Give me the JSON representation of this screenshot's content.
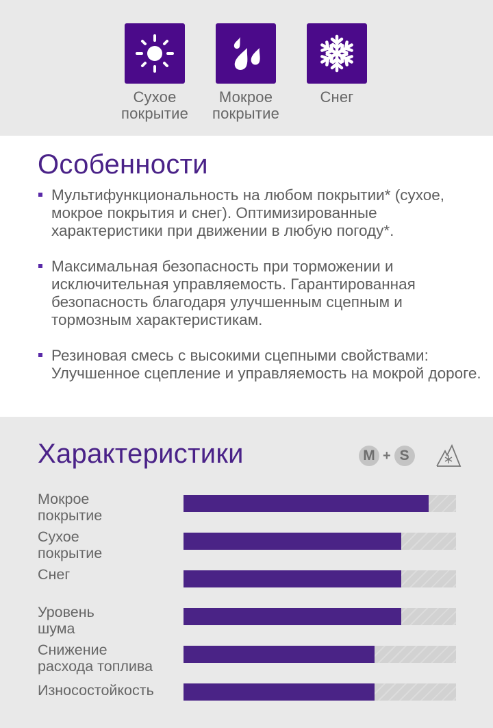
{
  "conditions": [
    {
      "icon": "sun-icon",
      "label_line1": "Сухое",
      "label_line2": "покрытие"
    },
    {
      "icon": "raindrops-icon",
      "label_line1": "Мокрое",
      "label_line2": "покрытие"
    },
    {
      "icon": "snowflake-icon",
      "label_line1": "Снег",
      "label_line2": ""
    }
  ],
  "features": {
    "title": "Особенности",
    "items": [
      "Мультифункциональность на любом покрытии* (сухое, мокрое покрытия и снег). Оптимизированные характеристики при движении в любую погоду*.",
      "Максимальная безопасность при торможении и исключительная управляемость. Гарантированная безопасность благодаря улучшенным сцепным и тормозным характеристикам.",
      "Резиновая смесь с высокими сцепными свойствами: Улучшенное сцепление и управляемость на мокрой  дороге."
    ]
  },
  "specs": {
    "title": "Характеристики",
    "badges": {
      "m": "M",
      "plus": "+",
      "s": "S",
      "alpine": "three-peak-mountain-snowflake-icon"
    },
    "rows": [
      {
        "line1": "Мокрое",
        "line2": "покрытие",
        "value": 0.9
      },
      {
        "line1": "Сухое",
        "line2": "покрытие",
        "value": 0.8
      },
      {
        "line1": "Снег",
        "line2": "",
        "value": 0.8
      },
      {
        "line1": "Уровень",
        "line2": "шума",
        "value": 0.8
      },
      {
        "line1": "Снижение",
        "line2": "расхода топлива",
        "value": 0.7
      },
      {
        "line1": "Износостойкость",
        "line2": "",
        "value": 0.7
      }
    ]
  },
  "colors": {
    "accent": "#4a2386",
    "icon_bg": "#4b0a8a",
    "track": "#d2d2d2"
  }
}
